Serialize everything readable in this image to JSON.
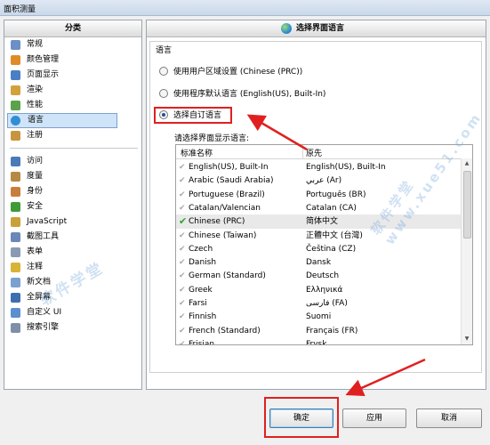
{
  "window": {
    "title": "面积测量"
  },
  "sidebar": {
    "header": "分类",
    "groups": [
      [
        {
          "label": "常规",
          "icon": "checklist-icon",
          "color": "#6b8fc7"
        },
        {
          "label": "颜色管理",
          "icon": "palette-icon",
          "color": "#e08b2a"
        },
        {
          "label": "页面显示",
          "icon": "page-display-icon",
          "color": "#4a7fc4"
        },
        {
          "label": "渲染",
          "icon": "render-icon",
          "color": "#d2a23a"
        },
        {
          "label": "性能",
          "icon": "performance-icon",
          "color": "#5aa34a"
        },
        {
          "label": "语言",
          "icon": "globe-icon",
          "color": "#2f8ed6",
          "selected": true
        },
        {
          "label": "注册",
          "icon": "user-icon",
          "color": "#c8953e"
        }
      ],
      [
        {
          "label": "访问",
          "icon": "access-icon",
          "color": "#4c7ab8"
        },
        {
          "label": "度量",
          "icon": "ruler-icon",
          "color": "#b58a45"
        },
        {
          "label": "身份",
          "icon": "identity-icon",
          "color": "#c97d3a"
        },
        {
          "label": "安全",
          "icon": "shield-icon",
          "color": "#3f9a3a"
        },
        {
          "label": "JavaScript",
          "icon": "javascript-icon",
          "color": "#c9a13a"
        },
        {
          "label": "截图工具",
          "icon": "screenshot-icon",
          "color": "#6b86b8"
        },
        {
          "label": "表单",
          "icon": "form-icon",
          "color": "#8a9ab5"
        },
        {
          "label": "注释",
          "icon": "comment-icon",
          "color": "#d8b33a"
        },
        {
          "label": "新文档",
          "icon": "new-document-icon",
          "color": "#7aa0d0"
        },
        {
          "label": "全屏幕",
          "icon": "fullscreen-icon",
          "color": "#3d6fb0"
        },
        {
          "label": "自定义 UI",
          "icon": "custom-ui-icon",
          "color": "#5c8fcf"
        },
        {
          "label": "搜索引擎",
          "icon": "search-icon",
          "color": "#7f8fa8"
        }
      ]
    ]
  },
  "content": {
    "header": "选择界面语言",
    "group_label": "语言",
    "options": [
      {
        "label": "使用用户区域设置 (Chinese (PRC))",
        "selected": false
      },
      {
        "label": "使用程序默认语言 (English(US), Built-In)",
        "selected": false
      },
      {
        "label": "选择自订语言",
        "selected": true
      }
    ],
    "prompt": "请选择界面显示语言:",
    "columns": [
      "标准名称",
      "原先"
    ],
    "languages": [
      {
        "name": "English(US), Built-In",
        "native": "English(US), Built-In",
        "selected": false
      },
      {
        "name": "Arabic (Saudi Arabia)",
        "native": "عربي (Ar)",
        "selected": false
      },
      {
        "name": "Portuguese (Brazil)",
        "native": "Português (BR)",
        "selected": false
      },
      {
        "name": "Catalan/Valencian",
        "native": "Catalan (CA)",
        "selected": false
      },
      {
        "name": "Chinese (PRC)",
        "native": "简体中文",
        "selected": true
      },
      {
        "name": "Chinese (Taiwan)",
        "native": "正體中文 (台灣)",
        "selected": false
      },
      {
        "name": "Czech",
        "native": "Čeština (CZ)",
        "selected": false
      },
      {
        "name": "Danish",
        "native": "Dansk",
        "selected": false
      },
      {
        "name": "German (Standard)",
        "native": "Deutsch",
        "selected": false
      },
      {
        "name": "Greek",
        "native": "Ελληνικά",
        "selected": false
      },
      {
        "name": "Farsi",
        "native": "فارسی (FA)",
        "selected": false
      },
      {
        "name": "Finnish",
        "native": "Suomi",
        "selected": false
      },
      {
        "name": "French (Standard)",
        "native": "Français (FR)",
        "selected": false
      },
      {
        "name": "Frisian",
        "native": "Frysk",
        "selected": false
      }
    ]
  },
  "buttons": {
    "ok": "确定",
    "apply": "应用",
    "cancel": "取消"
  },
  "watermark": "软件学堂 www.xue51.com",
  "colors": {
    "highlight_red": "#e02020",
    "selection_blue": "#cfe4f8"
  }
}
